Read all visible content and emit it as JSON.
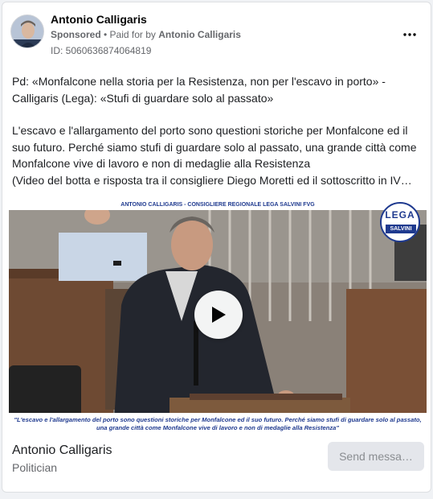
{
  "post": {
    "page_name": "Antonio Calligaris",
    "sponsored_label": "Sponsored",
    "paid_for_prefix": " • Paid for by ",
    "paid_for_name": "Antonio Calligaris",
    "ad_id": "ID: 5060636874064819",
    "more_icon": "more-dots-icon",
    "paragraphs": [
      "Pd: «Monfalcone nella storia per la Resistenza, non per l'escavo in porto» - Calligaris (Lega): «Stufi di guardare solo al passato»",
      "L'escavo e l'allargamento del porto sono questioni storiche per Monfalcone ed il suo futuro. Perché siamo stufi di guardare solo al passato, una grande città come Monfalcone vive di lavoro e non di medaglie alla Resistenza",
      "(Video del botta e risposta tra il consigliere Diego Moretti ed il sottoscritto in IV…"
    ]
  },
  "video": {
    "banner_prefix": "ANTONIO ",
    "banner_name": "CALLIGARIS",
    "banner_suffix": " - CONSIGLIERE REGIONALE LEGA SALVINI FVG",
    "logo_top": "LEGA",
    "logo_band": "SALVINI",
    "caption": "\"L'escavo e l'allargamento del porto sono questioni storiche per Monfalcone ed il suo futuro. Perché siamo stufi di guardare solo al passato, una grande città come Monfalcone vive di lavoro e non di medaglie alla Resistenza\"",
    "play_icon": "play-icon"
  },
  "footer": {
    "name": "Antonio Calligaris",
    "category": "Politician",
    "send_button": "Send messa…"
  },
  "colors": {
    "brand_blue": "#1f3a8f",
    "button_bg": "#e4e6eb",
    "muted_text": "#65676b"
  }
}
